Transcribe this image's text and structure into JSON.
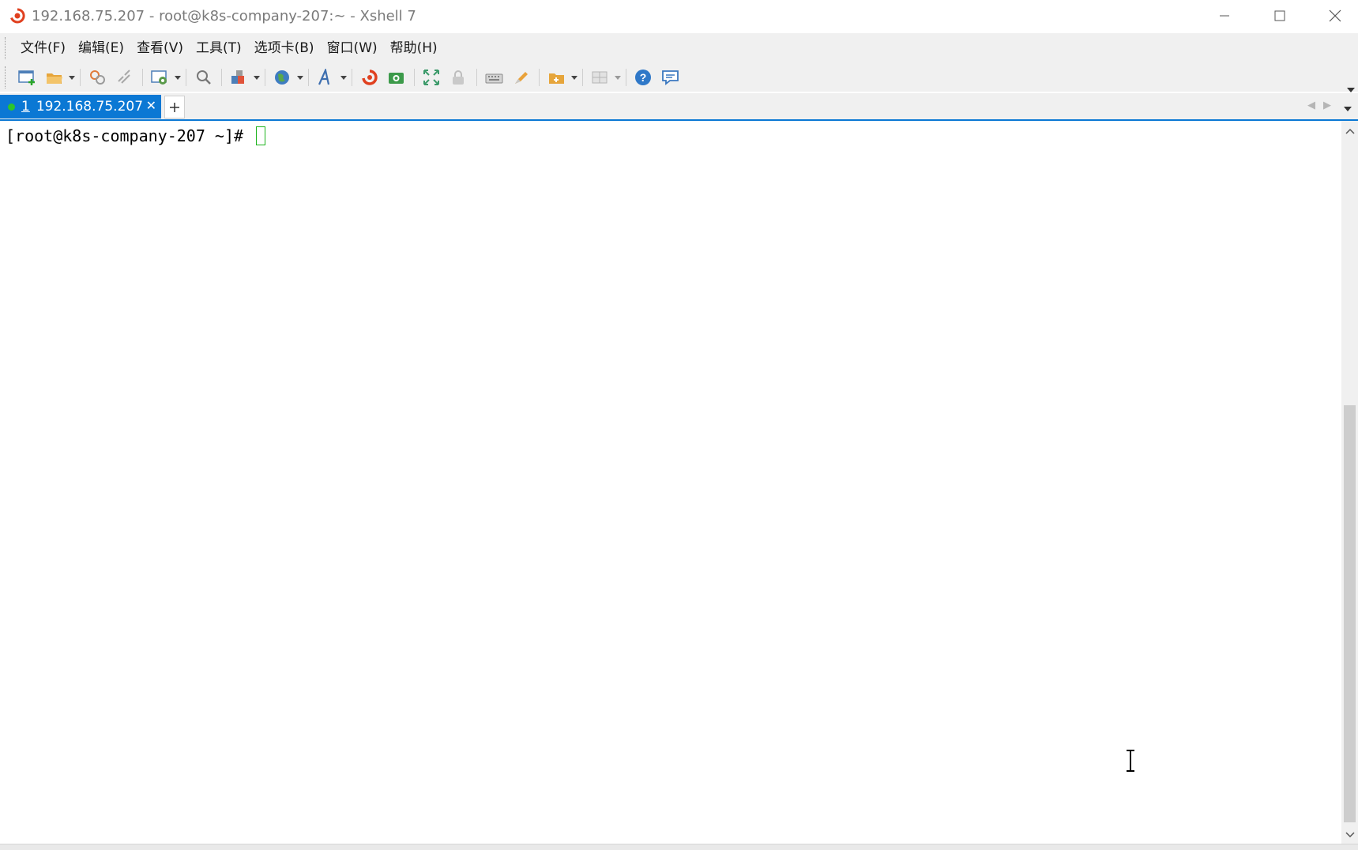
{
  "window": {
    "title": "192.168.75.207 - root@k8s-company-207:~ - Xshell 7"
  },
  "menu": [
    {
      "label": "文件(F)"
    },
    {
      "label": "编辑(E)"
    },
    {
      "label": "查看(V)"
    },
    {
      "label": "工具(T)"
    },
    {
      "label": "选项卡(B)"
    },
    {
      "label": "窗口(W)"
    },
    {
      "label": "帮助(H)"
    }
  ],
  "toolbar": {
    "icons": [
      "new-session-icon",
      "open-folder-icon",
      "connect-icon",
      "disconnect-icon",
      "properties-icon",
      "find-icon",
      "layout-icon",
      "globe-icon",
      "font-icon",
      "xshell-icon",
      "xftp-icon",
      "fullscreen-icon",
      "lock-icon",
      "keyboard-icon",
      "highlighter-icon",
      "new-folder-icon",
      "tile-icon",
      "help-icon",
      "chat-icon"
    ]
  },
  "tabs": [
    {
      "number": "1",
      "label": "192.168.75.207",
      "status_color": "#2cc52c",
      "active": true
    }
  ],
  "terminal": {
    "prompt": "[root@k8s-company-207 ~]# "
  },
  "colors": {
    "accent": "#0b78d4",
    "cursor": "#1db31d",
    "chrome": "#f0f0f0"
  }
}
